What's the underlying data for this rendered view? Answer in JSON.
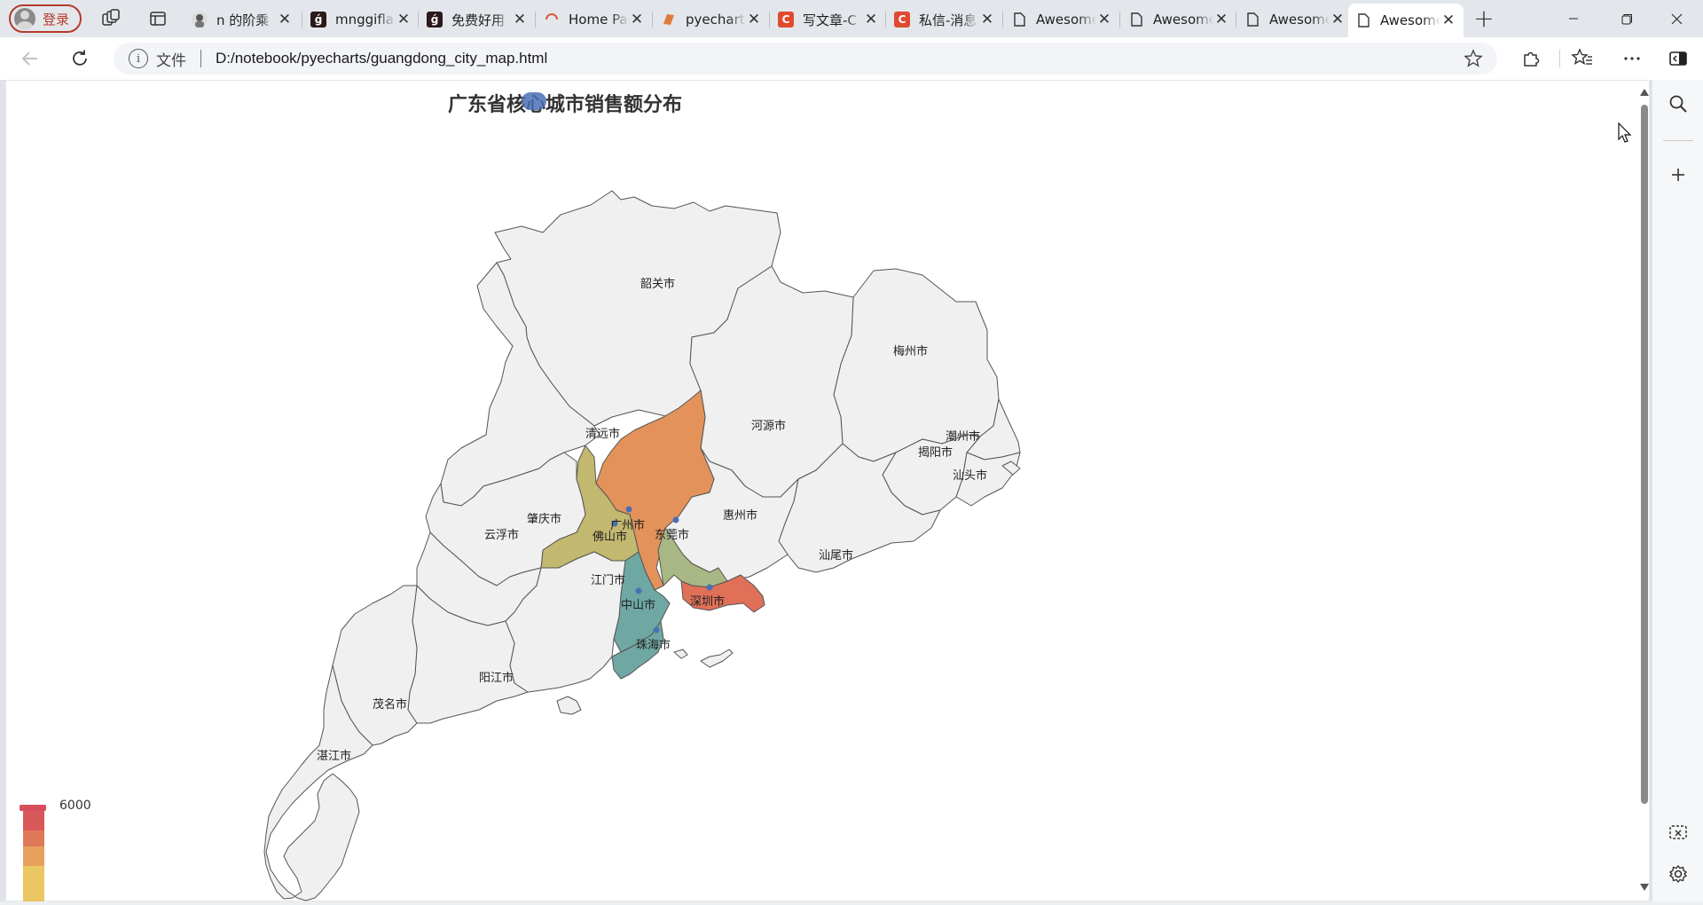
{
  "browser": {
    "profile_label": "登录",
    "tabs": [
      {
        "title": "n 的阶乘",
        "favicon": "avatar-favicon"
      },
      {
        "title": "mnggiflab",
        "favicon": "gif-favicon"
      },
      {
        "title": "免费好用",
        "favicon": "gif-favicon"
      },
      {
        "title": "Home Page",
        "favicon": "loading-favicon"
      },
      {
        "title": "pyecharts",
        "favicon": "pyecharts-favicon"
      },
      {
        "title": "写文章-C",
        "favicon": "csdn-favicon"
      },
      {
        "title": "私信-消息",
        "favicon": "csdn-favicon"
      },
      {
        "title": "Awesome",
        "favicon": "page-favicon"
      },
      {
        "title": "Awesome",
        "favicon": "page-favicon"
      },
      {
        "title": "Awesome",
        "favicon": "page-favicon"
      },
      {
        "title": "Awesome",
        "favicon": "page-favicon",
        "active": true
      }
    ],
    "address": {
      "scheme_label": "文件",
      "url": "D:/notebook/pyecharts/guangdong_city_map.html"
    }
  },
  "chart_data": {
    "type": "map",
    "title": "广东省核心城市销售额分布",
    "region": "广东",
    "highlighted_cities": [
      "广州市",
      "佛山市",
      "东莞市",
      "深圳市",
      "中山市",
      "珠海市",
      "江门市"
    ],
    "city_labels": [
      "韶关市",
      "梅州市",
      "清远市",
      "河源市",
      "潮州市",
      "揭阳市",
      "汕头市",
      "惠州市",
      "肇庆市",
      "广州市",
      "佛山市",
      "东莞市",
      "云浮市",
      "汕尾市",
      "江门市",
      "深圳市",
      "中山市",
      "珠海市",
      "阳江市",
      "茂名市",
      "湛江市"
    ],
    "visual_map": {
      "max_label": "6000",
      "colors": [
        "#d94e5d",
        "#e0795a",
        "#e8a05f",
        "#eac763"
      ]
    },
    "colors": {
      "guangzhou": "#e3935a",
      "foshan": "#c2b86f",
      "dongguan": "#a9b784",
      "shenzhen": "#e07058",
      "zhongshan_zhuhai": "#6fa7a2",
      "default_region": "#f0f0f0",
      "border": "#555555",
      "point": "#4a6fb5"
    }
  }
}
